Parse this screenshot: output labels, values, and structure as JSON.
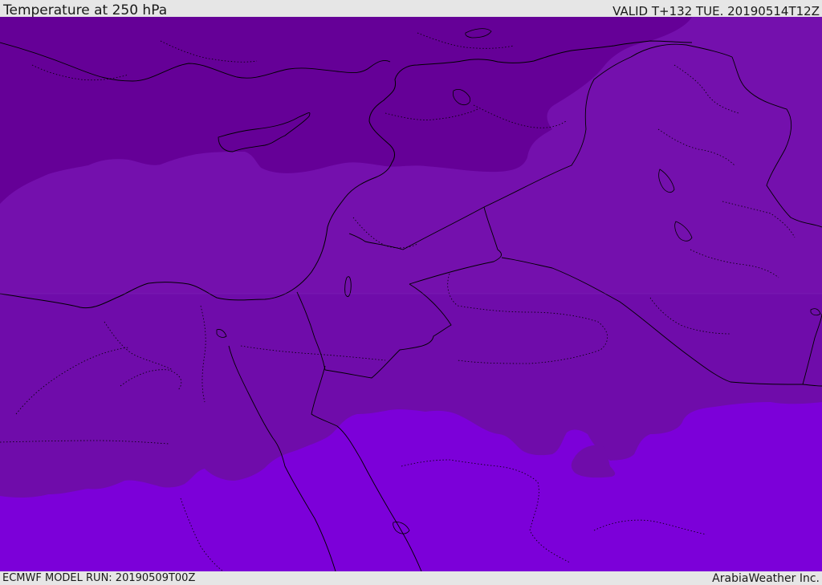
{
  "header": {
    "title": "Temperature at 250 hPa",
    "valid": "VALID T+132 TUE. 20190514T12Z"
  },
  "footer": {
    "model_run": "ECMWF MODEL RUN: 20190509T00Z",
    "credit": "ArabiaWeather Inc."
  },
  "colors": {
    "band_cold": "#650097",
    "band_mid_north": "#7410ad",
    "band_mid_south": "#6f0caa",
    "band_warm": "#7c00d9",
    "border": "#000000",
    "frame": "#e6e6e6"
  }
}
